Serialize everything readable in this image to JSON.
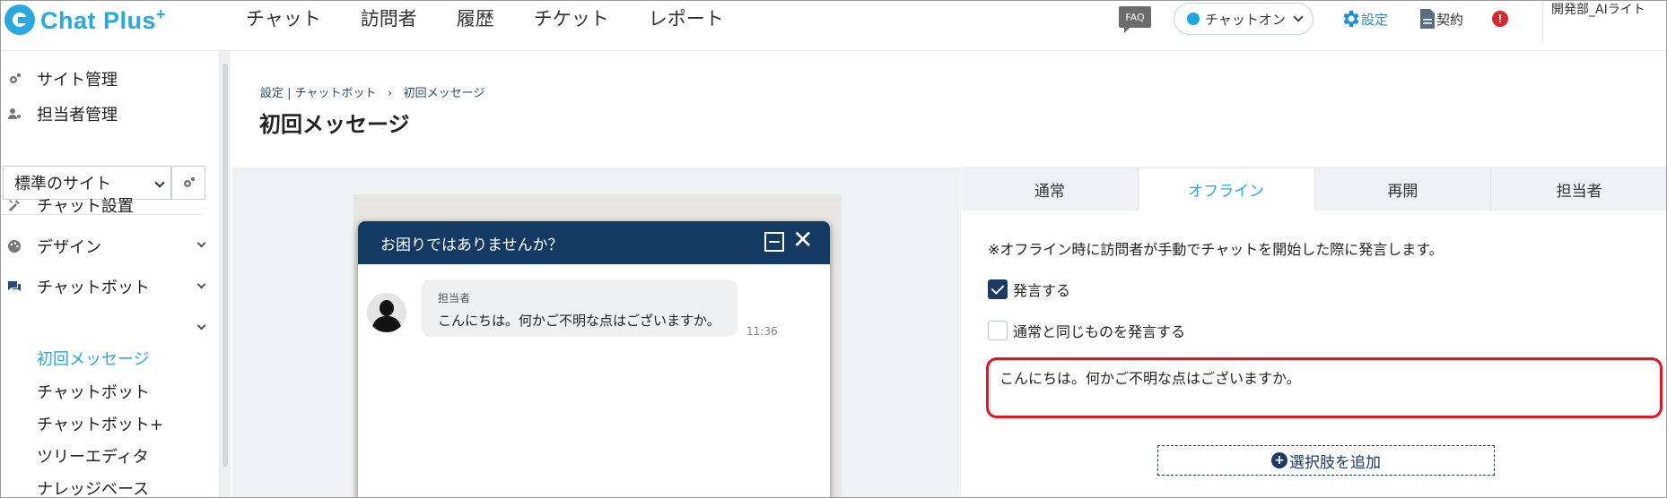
{
  "app": {
    "logo_text": "Chat Plus",
    "logo_plus": "+"
  },
  "nav": {
    "items": [
      "チャット",
      "訪問者",
      "履歴",
      "チケット",
      "レポート"
    ]
  },
  "header": {
    "faq_label": "FAQ",
    "chat_status_label": "チャットオン",
    "chat_status_color": "#1aa8e3",
    "settings_label": "設定",
    "contract_label": "契約",
    "alert_symbol": "!",
    "user_name": "開発部_AIライト"
  },
  "sidebar": {
    "site_admin": "サイト管理",
    "staff_admin": "担当者管理",
    "site_select_value": "標準のサイト",
    "chat_setup": "チャット設置",
    "design": "デザイン",
    "chatbot_group": "チャットボット",
    "subitems": [
      "初回メッセージ",
      "チャットボット",
      "チャットボット+",
      "ツリーエディタ",
      "ナレッジベース"
    ],
    "active_subitem": "初回メッセージ"
  },
  "breadcrumb": {
    "parts": [
      "設定",
      "チャットボット",
      "初回メッセージ"
    ],
    "separator_1": "|",
    "separator_2": "›"
  },
  "page": {
    "title": "初回メッセージ"
  },
  "preview": {
    "widget_title": "お困りではありませんか？",
    "sender_name": "担当者",
    "message": "こんにちは。何かご不明な点はございますか。",
    "time": "11:36"
  },
  "settings": {
    "tabs": [
      "通常",
      "オフライン",
      "再開",
      "担当者"
    ],
    "active_tab": "オフライン",
    "note": "※オフライン時に訪問者が手動でチャットを開始した際に発言します。",
    "speak_label": "発言する",
    "speak_checked": true,
    "same_as_normal_label": "通常と同じものを発言する",
    "same_as_normal_checked": false,
    "message_value": "こんにちは。何かご不明な点はございますか。",
    "add_choice_label": "選択肢を追加",
    "highlight_color": "#e3161d"
  }
}
